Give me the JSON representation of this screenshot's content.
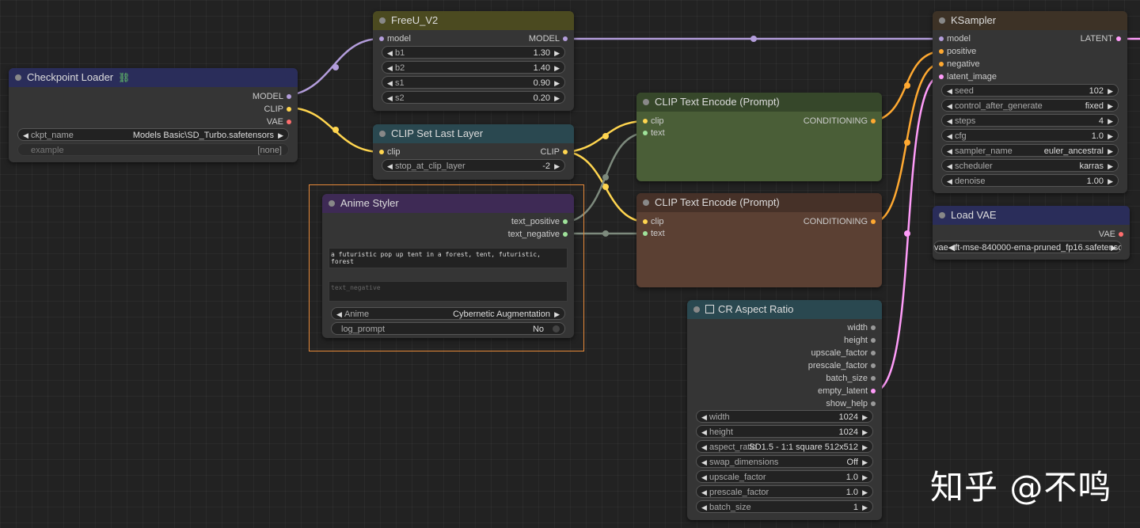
{
  "colors": {
    "model": "#b39ddb",
    "clip": "#ffd54f",
    "vae": "#ff6e6e",
    "conditioning": "#ffa931",
    "latent": "#ff9cf9",
    "string": "#9fe29a",
    "selection": "#e88a3a"
  },
  "checkpoint_loader": {
    "title": "Checkpoint Loader",
    "icon": "link-icon",
    "outputs": [
      "MODEL",
      "CLIP",
      "VAE"
    ],
    "ckpt_label": "ckpt_name",
    "ckpt_value": "Models Basic\\SD_Turbo.safetensors",
    "example_label": "example",
    "example_value": "[none]"
  },
  "freeu": {
    "title": "FreeU_V2",
    "input": "model",
    "output": "MODEL",
    "widgets": [
      {
        "label": "b1",
        "value": "1.30"
      },
      {
        "label": "b2",
        "value": "1.40"
      },
      {
        "label": "s1",
        "value": "0.90"
      },
      {
        "label": "s2",
        "value": "0.20"
      }
    ]
  },
  "clip_set_last": {
    "title": "CLIP Set Last Layer",
    "input": "clip",
    "output": "CLIP",
    "widget_label": "stop_at_clip_layer",
    "widget_value": "-2"
  },
  "anime_styler": {
    "title": "Anime Styler",
    "outputs": [
      "text_positive",
      "text_negative"
    ],
    "prompt": "a futuristic pop up tent in a forest, tent, futuristic, forest",
    "negative_placeholder": "text_negative",
    "style_label": "Anime",
    "style_value": "Cybernetic Augmentation",
    "log_label": "log_prompt",
    "log_value": "No"
  },
  "clip_encode_pos": {
    "title": "CLIP Text Encode (Prompt)",
    "inputs": [
      "clip",
      "text"
    ],
    "output": "CONDITIONING"
  },
  "clip_encode_neg": {
    "title": "CLIP Text Encode (Prompt)",
    "inputs": [
      "clip",
      "text"
    ],
    "output": "CONDITIONING"
  },
  "ksampler": {
    "title": "KSampler",
    "inputs": [
      "model",
      "positive",
      "negative",
      "latent_image"
    ],
    "output": "LATENT",
    "widgets": [
      {
        "label": "seed",
        "value": "102"
      },
      {
        "label": "control_after_generate",
        "value": "fixed"
      },
      {
        "label": "steps",
        "value": "4"
      },
      {
        "label": "cfg",
        "value": "1.0"
      },
      {
        "label": "sampler_name",
        "value": "euler_ancestral"
      },
      {
        "label": "scheduler",
        "value": "karras"
      },
      {
        "label": "denoise",
        "value": "1.00"
      }
    ]
  },
  "load_vae": {
    "title": "Load VAE",
    "output": "VAE",
    "widget_text": "vae◀ft-mse-840000-ema-pruned_fp16.safetensors"
  },
  "cr_aspect": {
    "title": "CR Aspect Ratio",
    "outputs": [
      "width",
      "height",
      "upscale_factor",
      "prescale_factor",
      "batch_size",
      "empty_latent",
      "show_help"
    ],
    "widgets": [
      {
        "label": "width",
        "value": "1024"
      },
      {
        "label": "height",
        "value": "1024"
      },
      {
        "label": "aspect_ratio",
        "value": "SD1.5 - 1:1 square 512x512"
      },
      {
        "label": "swap_dimensions",
        "value": "Off"
      },
      {
        "label": "upscale_factor",
        "value": "1.0"
      },
      {
        "label": "prescale_factor",
        "value": "1.0"
      },
      {
        "label": "batch_size",
        "value": "1"
      }
    ]
  },
  "watermark": "知乎 @不鸣"
}
